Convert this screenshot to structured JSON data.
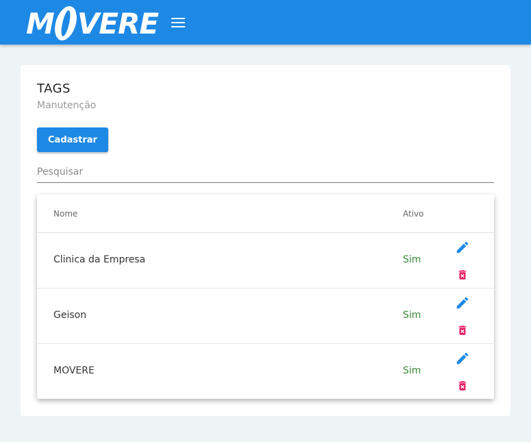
{
  "header": {
    "logo_left": "M",
    "logo_right": "VERE",
    "brand_color": "#1e88e5",
    "menu_icon": "hamburger-icon"
  },
  "page": {
    "title": "TAGS",
    "subtitle": "Manutenção",
    "primary_button": "Cadastrar",
    "search_placeholder": "Pesquisar",
    "search_value": ""
  },
  "table": {
    "columns": {
      "name": "Nome",
      "active": "Ativo"
    },
    "rows": [
      {
        "name": "Clinica da Empresa",
        "active": "Sim"
      },
      {
        "name": "Geison",
        "active": "Sim"
      },
      {
        "name": "MOVERE",
        "active": "Sim"
      }
    ],
    "edit_icon": "pencil-icon",
    "delete_icon": "trash-x-icon",
    "active_color": "#3a8a3a",
    "edit_color": "#1e88e5",
    "delete_color": "#e91e63"
  }
}
